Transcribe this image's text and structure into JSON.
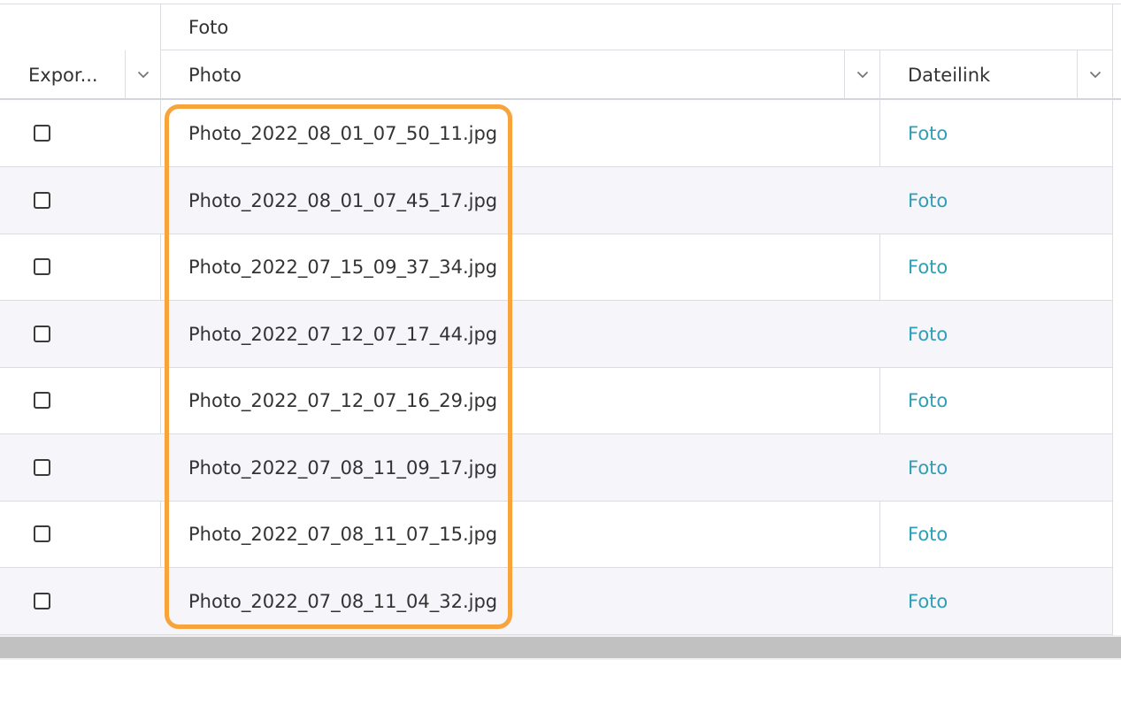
{
  "header": {
    "group_label": "Foto",
    "columns": [
      {
        "label": "Expor...",
        "menu_icon": "chevron-down-icon"
      },
      {
        "label": "Photo",
        "menu_icon": "chevron-down-icon"
      },
      {
        "label": "Dateilink",
        "menu_icon": "chevron-down-icon"
      }
    ]
  },
  "rows": [
    {
      "export_checked": false,
      "photo": "Photo_2022_08_01_07_50_11.jpg",
      "link": "Foto"
    },
    {
      "export_checked": false,
      "photo": "Photo_2022_08_01_07_45_17.jpg",
      "link": "Foto"
    },
    {
      "export_checked": false,
      "photo": "Photo_2022_07_15_09_37_34.jpg",
      "link": "Foto"
    },
    {
      "export_checked": false,
      "photo": "Photo_2022_07_12_07_17_44.jpg",
      "link": "Foto"
    },
    {
      "export_checked": false,
      "photo": "Photo_2022_07_12_07_16_29.jpg",
      "link": "Foto"
    },
    {
      "export_checked": false,
      "photo": "Photo_2022_07_08_11_09_17.jpg",
      "link": "Foto"
    },
    {
      "export_checked": false,
      "photo": "Photo_2022_07_08_11_07_15.jpg",
      "link": "Foto"
    },
    {
      "export_checked": false,
      "photo": "Photo_2022_07_08_11_04_32.jpg",
      "link": "Foto"
    }
  ],
  "colors": {
    "highlight": "#f8a43b",
    "link": "#2f9fb5",
    "row_alt": "#f5f5fa",
    "border": "#dcdde2"
  }
}
